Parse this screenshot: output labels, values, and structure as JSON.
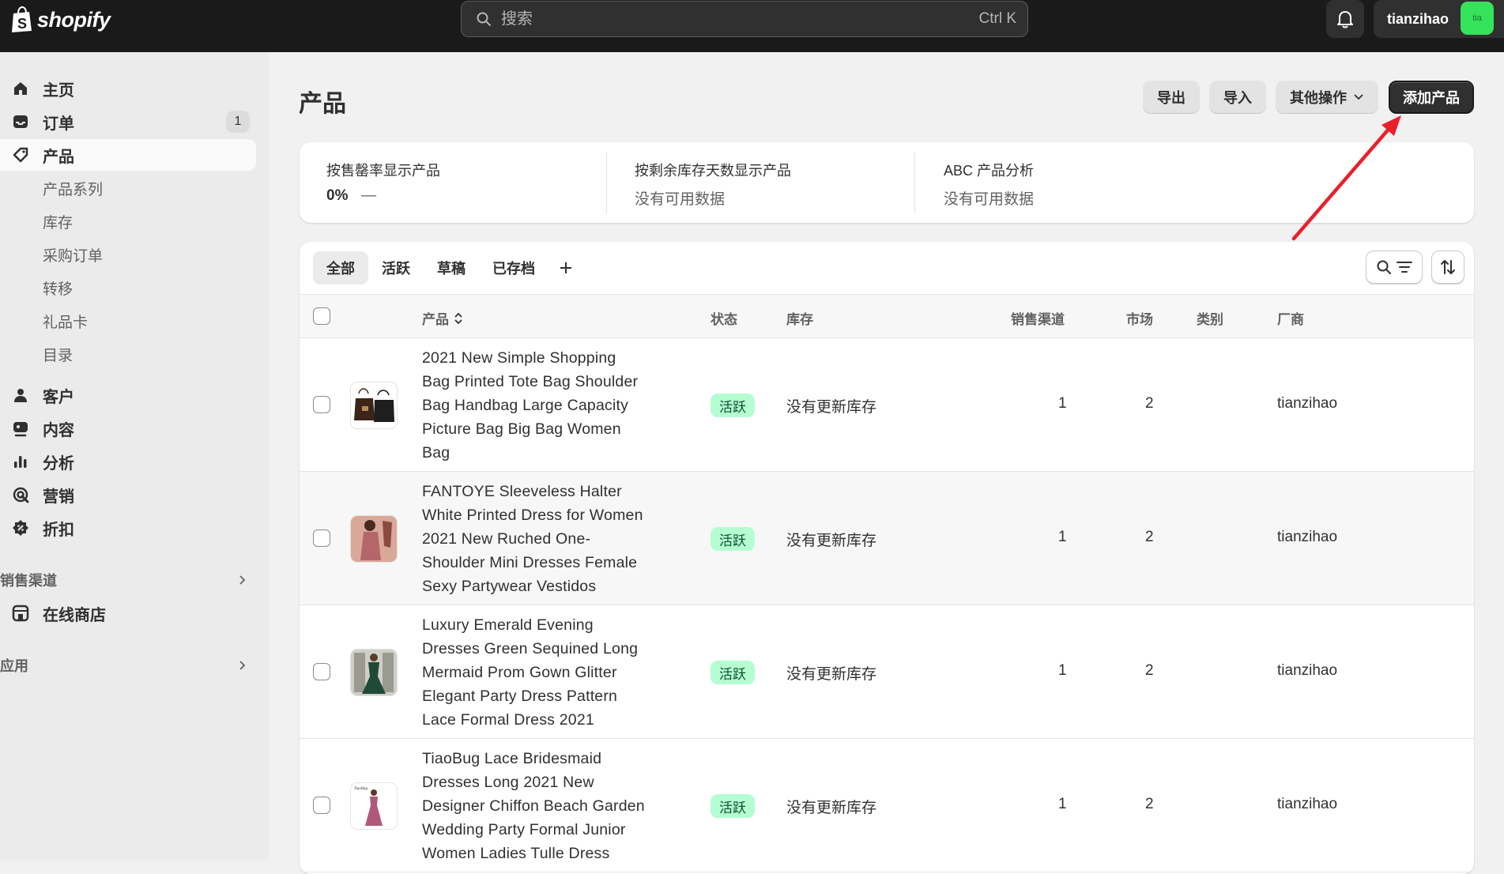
{
  "topbar": {
    "logo_text": "shopify",
    "search_placeholder": "搜索",
    "search_shortcut": "Ctrl K",
    "username": "tianzihao",
    "avatar_initials": "tia"
  },
  "sidebar": {
    "main_items": [
      {
        "label": "主页",
        "icon": "home-icon"
      },
      {
        "label": "订单",
        "icon": "inbox-icon",
        "badge": "1"
      },
      {
        "label": "产品",
        "icon": "tag-icon",
        "active": true
      }
    ],
    "product_sub_items": [
      "产品系列",
      "库存",
      "采购订单",
      "转移",
      "礼品卡",
      "目录"
    ],
    "more_items": [
      {
        "label": "客户",
        "icon": "person-icon"
      },
      {
        "label": "内容",
        "icon": "content-icon"
      },
      {
        "label": "分析",
        "icon": "bar-chart-icon"
      },
      {
        "label": "营销",
        "icon": "target-icon"
      },
      {
        "label": "折扣",
        "icon": "discount-icon"
      }
    ],
    "sales_channels_title": "销售渠道",
    "online_store_label": "在线商店",
    "apps_title": "应用"
  },
  "header": {
    "title": "产品",
    "export_label": "导出",
    "import_label": "导入",
    "more_actions_label": "其他操作",
    "add_product_label": "添加产品"
  },
  "stats": [
    {
      "label": "按售罄率显示产品",
      "value": "0%",
      "extra": "—"
    },
    {
      "label": "按剩余库存天数显示产品",
      "value": "没有可用数据"
    },
    {
      "label": "ABC 产品分析",
      "value": "没有可用数据"
    }
  ],
  "tabs": [
    "全部",
    "活跃",
    "草稿",
    "已存档"
  ],
  "columns": {
    "product": "产品",
    "status": "状态",
    "inventory": "库存",
    "sales_channels": "销售渠道",
    "markets": "市场",
    "category": "类别",
    "vendor": "厂商"
  },
  "products": [
    {
      "title_lines": [
        "2021 New Simple Shopping",
        "Bag Printed Tote Bag Shoulder",
        "Bag Handbag Large Capacity",
        "Picture Bag Big Bag Women",
        "Bag"
      ],
      "status": "活跃",
      "inventory": "没有更新库存",
      "sales_channels": "1",
      "markets": "2",
      "vendor": "tianzihao"
    },
    {
      "title_lines": [
        "FANTOYE Sleeveless Halter",
        "White Printed Dress for Women",
        "2021 New Ruched One-",
        "Shoulder Mini Dresses Female",
        "Sexy Partywear Vestidos"
      ],
      "status": "活跃",
      "inventory": "没有更新库存",
      "sales_channels": "1",
      "markets": "2",
      "vendor": "tianzihao"
    },
    {
      "title_lines": [
        "Luxury Emerald Evening",
        "Dresses Green Sequined Long",
        "Mermaid Prom Gown Glitter",
        "Elegant Party Dress Pattern",
        "Lace Formal Dress 2021"
      ],
      "status": "活跃",
      "inventory": "没有更新库存",
      "sales_channels": "1",
      "markets": "2",
      "vendor": "tianzihao"
    },
    {
      "title_lines": [
        "TiaoBug Lace Bridesmaid",
        "Dresses Long 2021 New",
        "Designer Chiffon Beach Garden",
        "Wedding Party Formal Junior",
        "Women Ladies Tulle Dress"
      ],
      "status": "活跃",
      "inventory": "没有更新库存",
      "sales_channels": "1",
      "markets": "2",
      "vendor": "tianzihao",
      "thumb_caption": "TiaoBug"
    }
  ],
  "colors": {
    "topbar": "#1a1a1a",
    "active_badge": "#b4fed2",
    "primary_button": "#303030",
    "annotation_arrow": "#e8202a"
  }
}
